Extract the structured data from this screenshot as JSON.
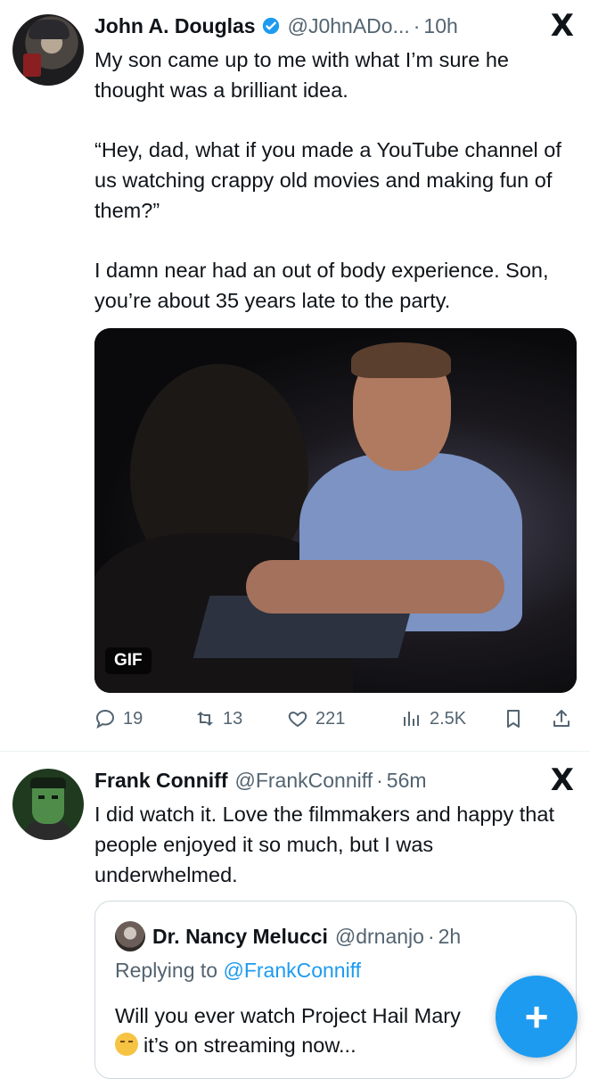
{
  "tweet1": {
    "name": "John A. Douglas",
    "handle": "@J0hnADo...",
    "time": "10h",
    "paragraphs": [
      "My son came up to me with what I’m sure he thought was a brilliant idea.",
      "“Hey, dad, what if you made a YouTube channel of us watching crappy old movies and making fun of them?”",
      "I damn near had an out of body experience. Son, you’re about 35 years late to the party."
    ],
    "media_badge": "GIF",
    "stats": {
      "replies": "19",
      "reposts": "13",
      "likes": "221",
      "views": "2.5K"
    }
  },
  "tweet2": {
    "name": "Frank Conniff",
    "handle": "@FrankConniff",
    "time": "56m",
    "text": "I did watch it. Love the filmmakers and happy that people enjoyed it so much, but I was underwhelmed."
  },
  "quote": {
    "name": "Dr. Nancy Melucci",
    "handle": "@drnanjo",
    "time": "2h",
    "replying_prefix": "Replying to",
    "replying_to": "@FrankConniff",
    "text_line1": "Will you ever watch Project Hail Mary",
    "text_line2": "it’s on streaming now..."
  },
  "separator": "·",
  "platform_logo": "X",
  "fab_label": "+",
  "colors": {
    "accent": "#1d9bf0",
    "text": "#0f1419",
    "secondary": "#536471"
  }
}
